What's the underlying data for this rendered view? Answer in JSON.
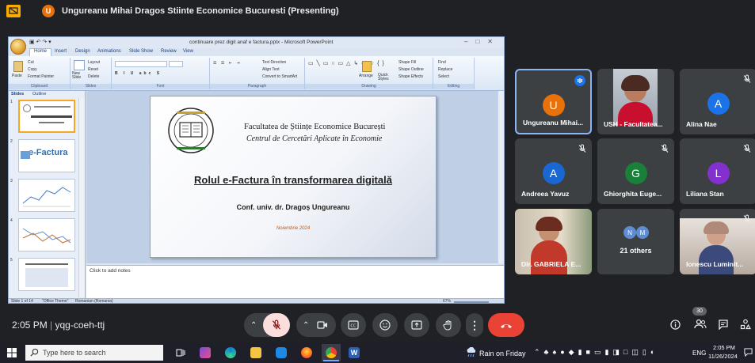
{
  "meeting": {
    "presenter_initial": "U",
    "title": "Ungureanu Mihai Dragos Stiinte Economice Bucuresti (Presenting)"
  },
  "ppt": {
    "window_title": "continuare prez digit anaf e factura.pptx - Microsoft PowerPoint",
    "tabs": [
      "Home",
      "Insert",
      "Design",
      "Animations",
      "Slide Show",
      "Review",
      "View"
    ],
    "groups": [
      "Clipboard",
      "Slides",
      "Font",
      "Paragraph",
      "Drawing",
      "Editing"
    ],
    "clipboard_items": [
      "Cut",
      "Copy",
      "Format Painter"
    ],
    "paste_label": "Paste",
    "slides_items": [
      "Layout",
      "Reset",
      "Delete"
    ],
    "new_slide_label": "New Slide",
    "paragraph_items": [
      "Text Direction",
      "Align Text",
      "Convert to SmartArt"
    ],
    "drawing_items": [
      "Shape Fill",
      "Shape Outline",
      "Shape Effects"
    ],
    "arrange_label": "Arrange",
    "quick_styles_label": "Quick Styles",
    "editing_items": [
      "Find",
      "Replace",
      "Select"
    ],
    "pane_tabs": [
      "Slides",
      "Outline"
    ],
    "slide": {
      "faculty": "Facultatea de Științe Economice București",
      "center": "Centrul de Cercetări Aplicate în Economie",
      "title": "Rolul e-Factura în transformarea digitală",
      "author": "Conf. univ. dr. Dragoș Ungureanu",
      "date": "Noiembrie 2024"
    },
    "thumb2_text": "e-Factura",
    "notes_placeholder": "Click to add notes",
    "status_slide": "Slide 1 of 14",
    "status_theme": "\"Office Theme\"",
    "status_lang": "Romanian (Romania)",
    "zoom": "67%"
  },
  "participants": [
    {
      "name": "Ungureanu Mihai...",
      "initial": "U",
      "color": "#e8710a",
      "speaking": true
    },
    {
      "name": "USH - Facultatea...",
      "video": true
    },
    {
      "name": "Alina Nae",
      "initial": "A",
      "color": "#1a73e8"
    },
    {
      "name": "Andreea Yavuz",
      "initial": "A",
      "color": "#1967d2"
    },
    {
      "name": "Ghiorghita Euge...",
      "initial": "G",
      "color": "#188038"
    },
    {
      "name": "Liliana Stan",
      "initial": "L",
      "color": "#8430ce"
    },
    {
      "name": "Dir. GABRIELA E...",
      "video": true
    },
    {
      "name": "21 others",
      "initials": [
        "N",
        "M"
      ],
      "color": "#5f8dd3"
    },
    {
      "name": "Ionescu Luminit...",
      "video": true
    }
  ],
  "controls": {
    "time": "2:05 PM",
    "meeting_code": "yqg-coeh-ttj",
    "participant_count": "30"
  },
  "taskbar": {
    "search_placeholder": "Type here to search",
    "weather": "Rain on Friday",
    "lang": "ENG",
    "time": "2:05 PM",
    "date": "11/26/2024"
  }
}
